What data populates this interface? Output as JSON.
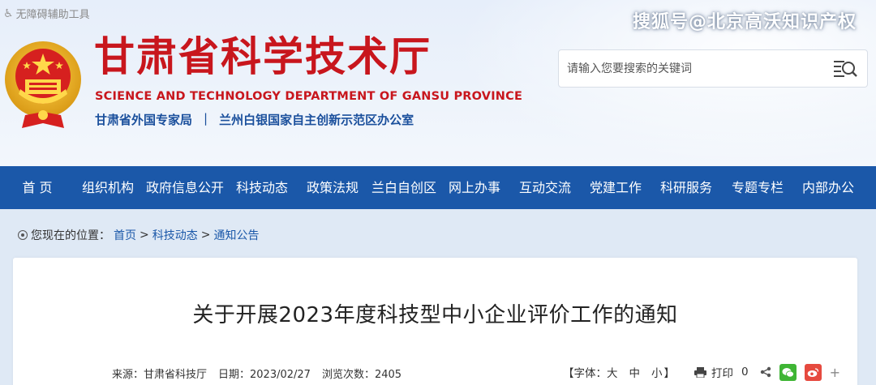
{
  "header": {
    "accessibility_tools": "无障碍辅助工具",
    "watermark": "搜狐号@北京高沃知识产权",
    "title_cn": "甘肃省科学技术厅",
    "title_en": "SCIENCE AND TECHNOLOGY DEPARTMENT OF GANSU PROVINCE",
    "sub_org_1": "甘肃省外国专家局",
    "sub_sep": "|",
    "sub_org_2": "兰州白银国家自主创新示范区办公室",
    "search_placeholder": "请输入您要搜索的关键词"
  },
  "nav": {
    "items": [
      "首 页",
      "组织机构",
      "政府信息公开",
      "科技动态",
      "政策法规",
      "兰白自创区",
      "网上办事",
      "互动交流",
      "党建工作",
      "科研服务",
      "专题专栏",
      "内部办公"
    ]
  },
  "breadcrumb": {
    "label": "您现在的位置：",
    "home": "首页",
    "sep": ">",
    "level1": "科技动态",
    "level2": "通知公告"
  },
  "article": {
    "title": "关于开展2023年度科技型中小企业评价工作的通知",
    "source": "来源：甘肃省科技厅",
    "date": "日期：2023/02/27",
    "views": "浏览次数：2405",
    "font_label": "【字体：",
    "font_large": "大",
    "font_medium": "中",
    "font_small": "小",
    "font_close": "】",
    "print_label": "打印",
    "share_count": "0",
    "plus": "+"
  },
  "colors": {
    "nav_bg": "#1b58a9",
    "title_red": "#c8161d",
    "sub_blue": "#1a4f9c",
    "link_blue": "#1b58a9"
  }
}
